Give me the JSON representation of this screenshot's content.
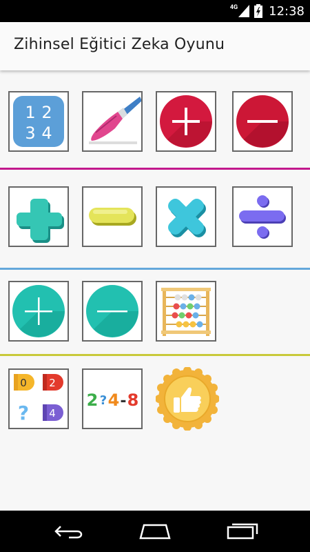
{
  "status_bar": {
    "network": "4G",
    "time": "12:38"
  },
  "app_bar": {
    "title": "Zihinsel Eğitici Zeka Oyunu"
  },
  "sections": [
    {
      "divider_color": "#c2188d",
      "tiles": [
        {
          "name": "numbers-1234-tile",
          "icon": "numbers-grid-icon",
          "digits": [
            "1",
            "2",
            "3",
            "4"
          ]
        },
        {
          "name": "paint-brush-tile",
          "icon": "paint-brush-icon"
        },
        {
          "name": "addition-red-tile",
          "icon": "plus-circle-red-icon"
        },
        {
          "name": "subtraction-red-tile",
          "icon": "minus-circle-red-icon"
        }
      ]
    },
    {
      "divider_color": "#64a8db",
      "tiles": [
        {
          "name": "addition-3d-tile",
          "icon": "plus-3d-icon"
        },
        {
          "name": "subtraction-3d-tile",
          "icon": "minus-3d-icon"
        },
        {
          "name": "multiplication-3d-tile",
          "icon": "times-3d-icon"
        },
        {
          "name": "division-3d-tile",
          "icon": "divide-3d-icon"
        }
      ]
    },
    {
      "divider_color": "#c8c93a",
      "tiles": [
        {
          "name": "addition-teal-tile",
          "icon": "plus-circle-teal-icon"
        },
        {
          "name": "subtraction-teal-tile",
          "icon": "minus-circle-teal-icon"
        },
        {
          "name": "abacus-tile",
          "icon": "abacus-icon"
        }
      ]
    },
    {
      "tiles": [
        {
          "name": "number-pattern-tile",
          "icon": "number-tags-icon",
          "digits": [
            "0",
            "2",
            "?",
            "4"
          ]
        },
        {
          "name": "sequence-tile",
          "icon": "sequence-icon",
          "text": [
            "2",
            "?",
            "4",
            "-",
            "8"
          ]
        },
        {
          "name": "thumbs-up-badge",
          "icon": "thumbs-up-badge-icon"
        }
      ]
    }
  ],
  "nav_bar": {
    "buttons": [
      "back-icon",
      "home-icon",
      "recents-icon"
    ]
  }
}
